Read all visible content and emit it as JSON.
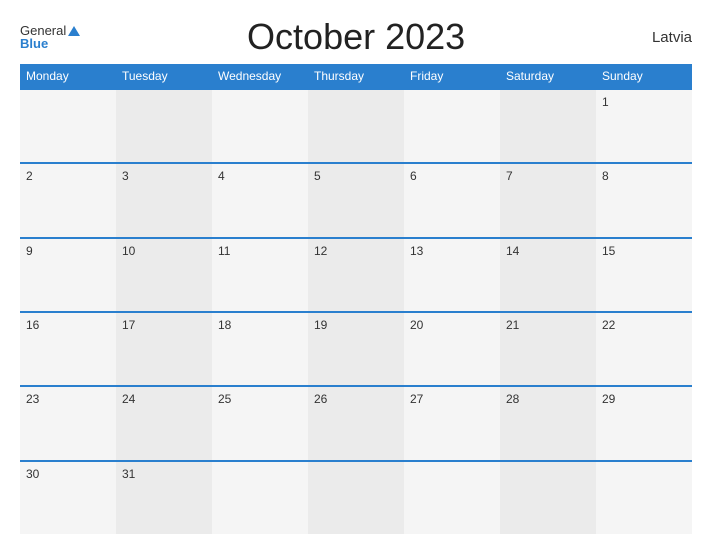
{
  "header": {
    "logo_general": "General",
    "logo_blue": "Blue",
    "title": "October 2023",
    "country": "Latvia"
  },
  "weekdays": [
    "Monday",
    "Tuesday",
    "Wednesday",
    "Thursday",
    "Friday",
    "Saturday",
    "Sunday"
  ],
  "weeks": [
    [
      {
        "day": "",
        "empty": true
      },
      {
        "day": "",
        "empty": true
      },
      {
        "day": "",
        "empty": true
      },
      {
        "day": "",
        "empty": true
      },
      {
        "day": "",
        "empty": true
      },
      {
        "day": "",
        "empty": true
      },
      {
        "day": "1",
        "empty": false
      }
    ],
    [
      {
        "day": "2",
        "empty": false
      },
      {
        "day": "3",
        "empty": false
      },
      {
        "day": "4",
        "empty": false
      },
      {
        "day": "5",
        "empty": false
      },
      {
        "day": "6",
        "empty": false
      },
      {
        "day": "7",
        "empty": false
      },
      {
        "day": "8",
        "empty": false
      }
    ],
    [
      {
        "day": "9",
        "empty": false
      },
      {
        "day": "10",
        "empty": false
      },
      {
        "day": "11",
        "empty": false
      },
      {
        "day": "12",
        "empty": false
      },
      {
        "day": "13",
        "empty": false
      },
      {
        "day": "14",
        "empty": false
      },
      {
        "day": "15",
        "empty": false
      }
    ],
    [
      {
        "day": "16",
        "empty": false
      },
      {
        "day": "17",
        "empty": false
      },
      {
        "day": "18",
        "empty": false
      },
      {
        "day": "19",
        "empty": false
      },
      {
        "day": "20",
        "empty": false
      },
      {
        "day": "21",
        "empty": false
      },
      {
        "day": "22",
        "empty": false
      }
    ],
    [
      {
        "day": "23",
        "empty": false
      },
      {
        "day": "24",
        "empty": false
      },
      {
        "day": "25",
        "empty": false
      },
      {
        "day": "26",
        "empty": false
      },
      {
        "day": "27",
        "empty": false
      },
      {
        "day": "28",
        "empty": false
      },
      {
        "day": "29",
        "empty": false
      }
    ],
    [
      {
        "day": "30",
        "empty": false
      },
      {
        "day": "31",
        "empty": false
      },
      {
        "day": "",
        "empty": true
      },
      {
        "day": "",
        "empty": true
      },
      {
        "day": "",
        "empty": true
      },
      {
        "day": "",
        "empty": true
      },
      {
        "day": "",
        "empty": true
      }
    ]
  ]
}
